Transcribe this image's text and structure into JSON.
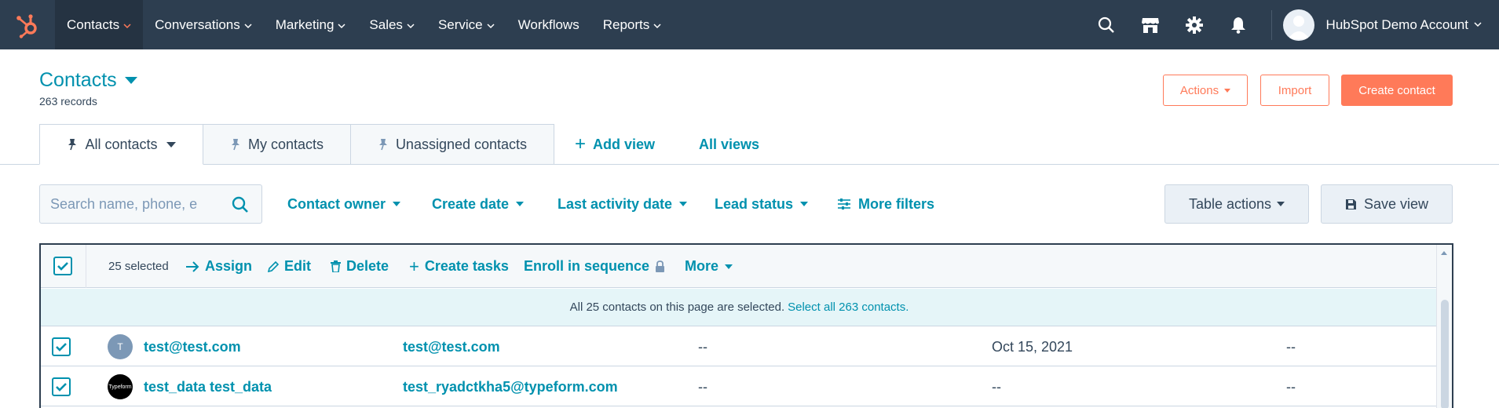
{
  "nav": {
    "items": [
      {
        "label": "Contacts",
        "active": true
      },
      {
        "label": "Conversations"
      },
      {
        "label": "Marketing"
      },
      {
        "label": "Sales"
      },
      {
        "label": "Service"
      },
      {
        "label": "Workflows"
      },
      {
        "label": "Reports"
      }
    ],
    "account_name": "HubSpot Demo Account"
  },
  "header": {
    "title": "Contacts",
    "record_count": "263 records",
    "actions_label": "Actions",
    "import_label": "Import",
    "create_label": "Create contact"
  },
  "views": {
    "tabs": [
      {
        "label": "All contacts",
        "active": true
      },
      {
        "label": "My contacts"
      },
      {
        "label": "Unassigned contacts"
      }
    ],
    "add_view": "Add view",
    "all_views": "All views"
  },
  "filters": {
    "search_placeholder": "Search name, phone, e",
    "contact_owner": "Contact owner",
    "create_date": "Create date",
    "last_activity_date": "Last activity date",
    "lead_status": "Lead status",
    "more_filters": "More filters",
    "table_actions": "Table actions",
    "save_view": "Save view"
  },
  "bulk": {
    "selected": "25 selected",
    "assign": "Assign",
    "edit": "Edit",
    "delete": "Delete",
    "create_tasks": "Create tasks",
    "enroll": "Enroll in sequence",
    "more": "More",
    "notice_text": "All 25 contacts on this page are selected.",
    "notice_link": "Select all 263 contacts."
  },
  "rows": [
    {
      "avatar": "T",
      "name": "test@test.com",
      "email": "test@test.com",
      "phone": "--",
      "date": "Oct 15, 2021",
      "status": "--"
    },
    {
      "avatar": "Typeform",
      "name": "test_data test_data",
      "email": "test_ryadctkha5@typeform.com",
      "phone": "--",
      "date": "--",
      "status": "--"
    }
  ],
  "colors": {
    "nav_bg": "#2d3e50",
    "accent": "#ff7a59",
    "link": "#0091ae",
    "text": "#33475b"
  }
}
